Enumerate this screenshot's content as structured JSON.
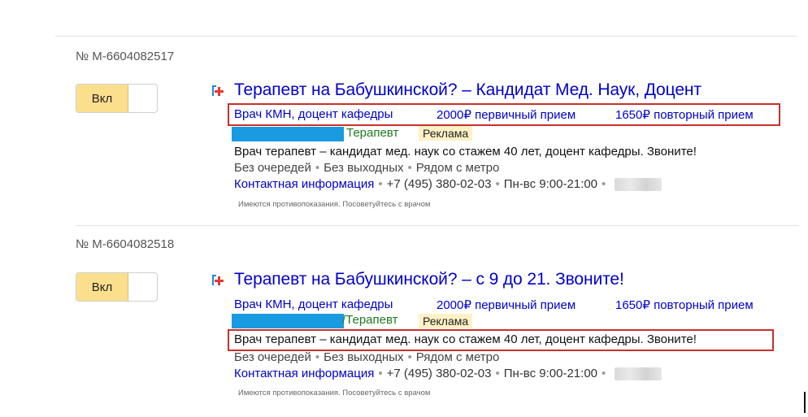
{
  "ads": [
    {
      "number": "№ M-6604082517",
      "toggle_label": "Вкл",
      "title": "Терапевт на Бабушкинской? – Кандидат Мед. Наук, Доцент",
      "sitelinks": [
        "Врач КМН, доцент кафедры",
        "2000₽ первичный прием",
        "1650₽ повторный прием"
      ],
      "url_path": "Терапевт",
      "badge": "Реклама",
      "description": "Врач терапевт – кандидат мед. наук со стажем 40 лет, доцент кафедры. Звоните!",
      "callouts": [
        "Без очередей",
        "Без выходных",
        "Рядом с метро"
      ],
      "contact_link": "Контактная информация",
      "phone": "+7 (495) 380-02-03",
      "hours": "Пн-вс 9:00-21:00",
      "warning": "Имеются противопоказания. Посоветуйтесь с врачом"
    },
    {
      "number": "№ M-6604082518",
      "toggle_label": "Вкл",
      "title": "Терапевт на Бабушкинской? – с 9 до 21. Звоните!",
      "sitelinks": [
        "Врач КМН, доцент кафедры",
        "2000₽ первичный прием",
        "1650₽ повторный прием"
      ],
      "url_path": "/Терапевт",
      "badge": "Реклама",
      "description": "Врач терапевт – кандидат мед. наук со стажем 40 лет, доцент кафедры. Звоните!",
      "callouts": [
        "Без очередей",
        "Без выходных",
        "Рядом с метро"
      ],
      "contact_link": "Контактная информация",
      "phone": "+7 (495) 380-02-03",
      "hours": "Пн-вс 9:00-21:00",
      "warning": "Имеются противопоказания. Посоветуйтесь с врачом"
    }
  ],
  "colors": {
    "link": "#0000cc",
    "url": "#1f7a1f",
    "highlight_box": "#c9302c",
    "toggle_on": "#fcdf8c",
    "badge_bg": "#fdf1c5"
  }
}
